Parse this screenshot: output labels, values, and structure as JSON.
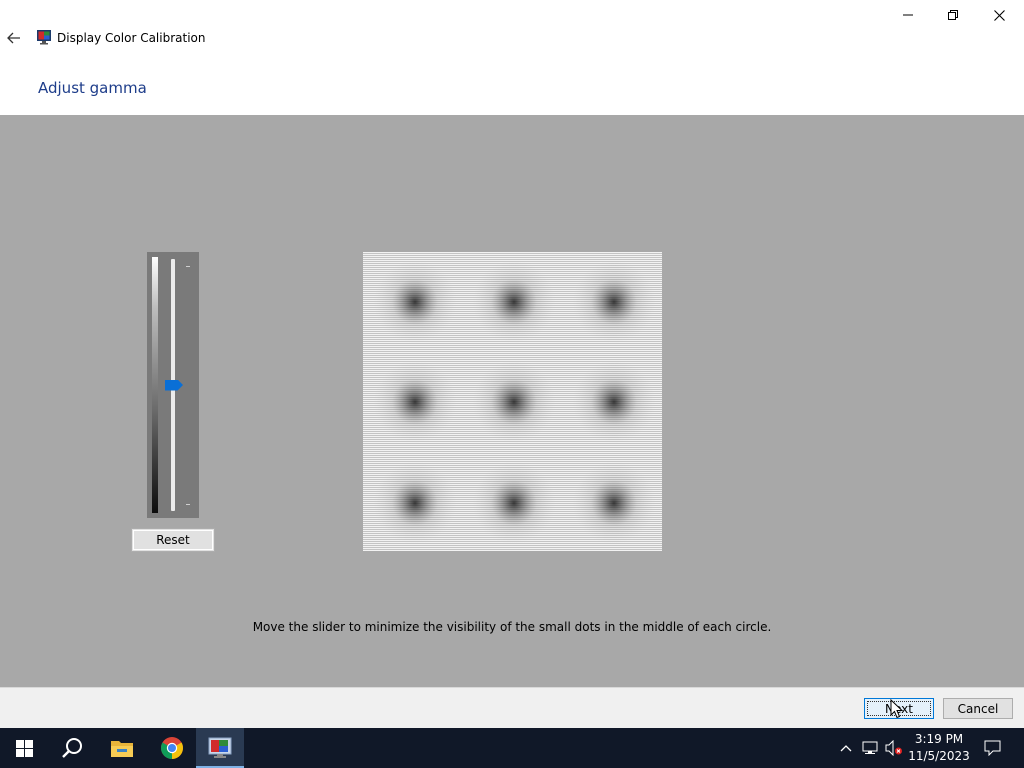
{
  "window": {
    "title": "Display Color Calibration",
    "back_icon": "arrow-left-icon",
    "app_icon": "display-calibration-icon",
    "controls": [
      "minimize-icon",
      "maximize-icon",
      "close-icon"
    ]
  },
  "page": {
    "heading": "Adjust gamma"
  },
  "gamma": {
    "slider_value_fraction": 0.5,
    "reset_label": "Reset",
    "instruction": "Move the slider to minimize the visibility of the small dots in the middle of each circle."
  },
  "footer": {
    "next_label": "Next",
    "cancel_label": "Cancel"
  },
  "taskbar": {
    "items": [
      "windows-start-icon",
      "search-icon",
      "file-explorer-icon",
      "chrome-icon",
      "display-calibration-icon"
    ],
    "tray": [
      "chevron-up-icon",
      "network-icon",
      "volume-muted-icon",
      "notification-icon"
    ],
    "time": "3:19 PM",
    "date": "11/5/2023"
  },
  "colors": {
    "heading": "#1e3d8a",
    "content_bg": "#a8a8a8",
    "slider_thumb": "#0a6fd6",
    "taskbar_bg": "#101828",
    "focus_border": "#0078d7"
  }
}
